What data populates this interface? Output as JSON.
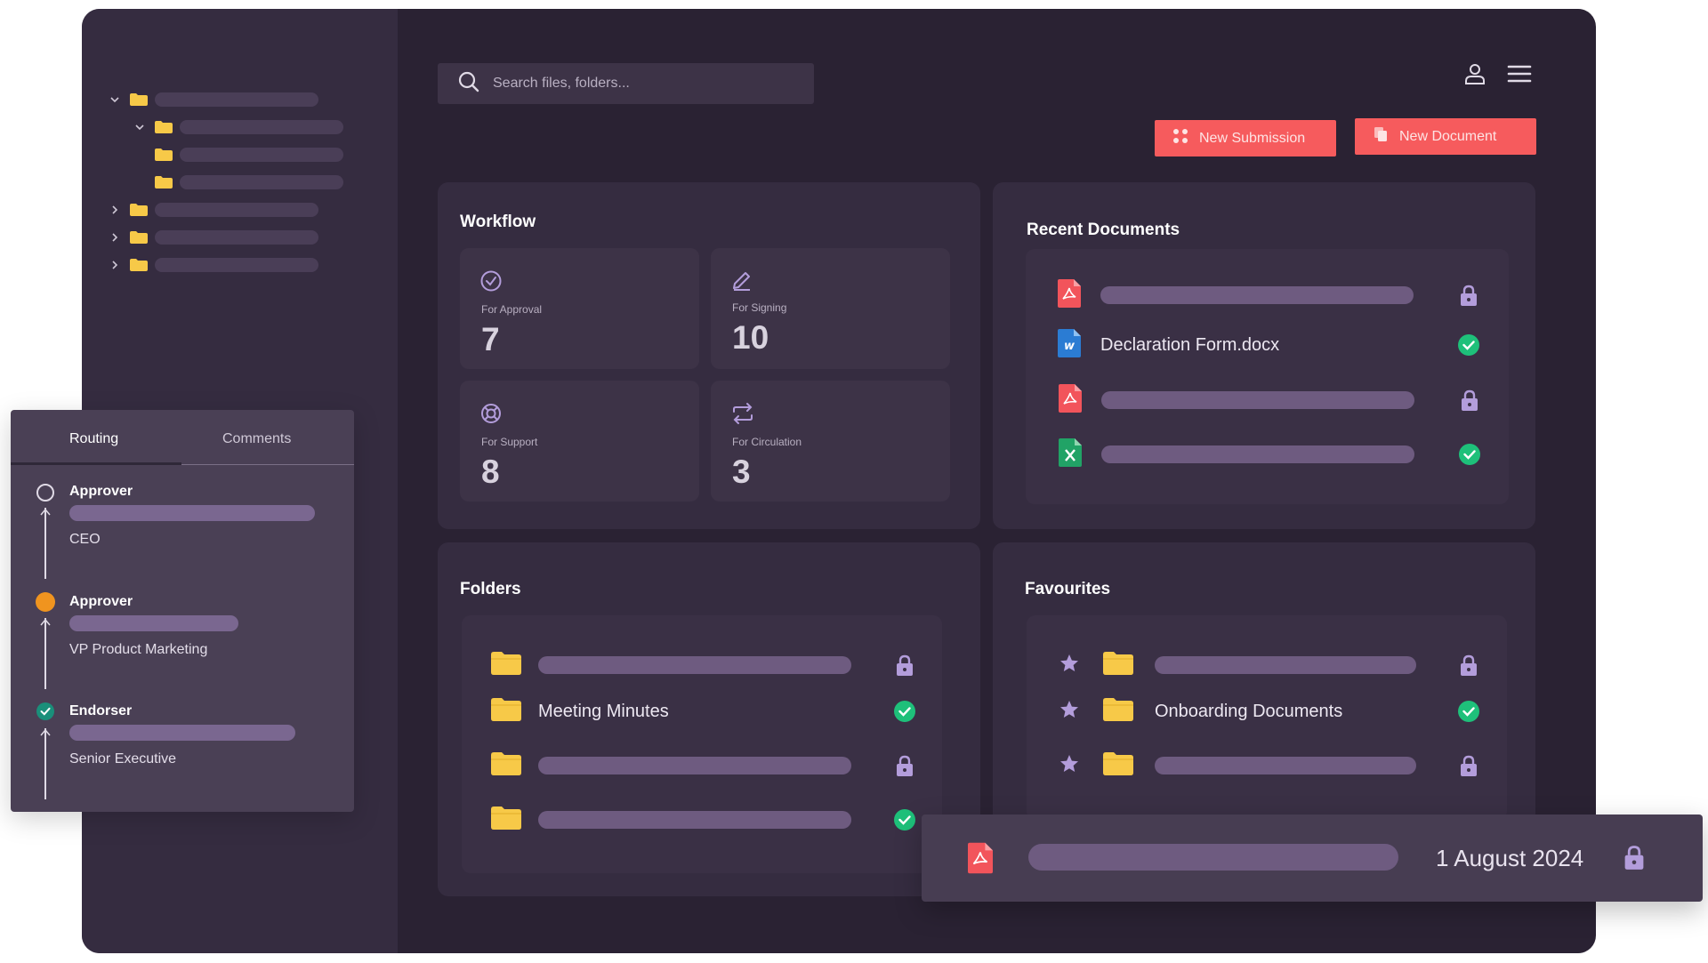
{
  "search": {
    "placeholder": "Search files, folders..."
  },
  "header": {
    "user_icon": "user-icon",
    "menu_icon": "hamburger-menu-icon"
  },
  "actions": {
    "new_submission": "New Submission",
    "new_document": "New Document"
  },
  "workflow": {
    "title": "Workflow",
    "tiles": [
      {
        "label": "For Approval",
        "count": "7",
        "icon": "check-circle-icon"
      },
      {
        "label": "For Signing",
        "count": "10",
        "icon": "pen-icon"
      },
      {
        "label": "For Support",
        "count": "8",
        "icon": "lifebuoy-icon"
      },
      {
        "label": "For Circulation",
        "count": "3",
        "icon": "repeat-icon"
      }
    ]
  },
  "recent_documents": {
    "title": "Recent Documents",
    "items": [
      {
        "type": "pdf",
        "name": "",
        "status": "locked"
      },
      {
        "type": "word",
        "name": "Declaration Form.docx",
        "status": "approved"
      },
      {
        "type": "pdf",
        "name": "",
        "status": "locked"
      },
      {
        "type": "excel",
        "name": "",
        "status": "approved"
      }
    ]
  },
  "folders": {
    "title": "Folders",
    "items": [
      {
        "name": "",
        "status": "locked"
      },
      {
        "name": "Meeting Minutes",
        "status": "approved"
      },
      {
        "name": "",
        "status": "locked"
      },
      {
        "name": "",
        "status": "approved"
      }
    ]
  },
  "favourites": {
    "title": "Favourites",
    "items": [
      {
        "name": "",
        "status": "locked"
      },
      {
        "name": "Onboarding Documents",
        "status": "approved"
      },
      {
        "name": "",
        "status": "locked"
      }
    ]
  },
  "routing": {
    "tabs": [
      "Routing",
      "Comments"
    ],
    "active_tab": "Routing",
    "steps": [
      {
        "role": "Approver",
        "title": "CEO",
        "state": "pending"
      },
      {
        "role": "Approver",
        "title": "VP Product Marketing",
        "state": "current"
      },
      {
        "role": "Endorser",
        "title": "Senior Executive",
        "state": "done"
      }
    ]
  },
  "floating_file": {
    "type": "pdf",
    "date": "1 August 2024",
    "status": "locked"
  },
  "colors": {
    "accent": "#f65b5d",
    "background": "#2a2233",
    "panel": "#352c40",
    "success": "#1ec07a",
    "lock": "#b39ddb",
    "folder": "#f7c948",
    "current_step": "#f0941f",
    "done_step": "#1a8f7a"
  }
}
